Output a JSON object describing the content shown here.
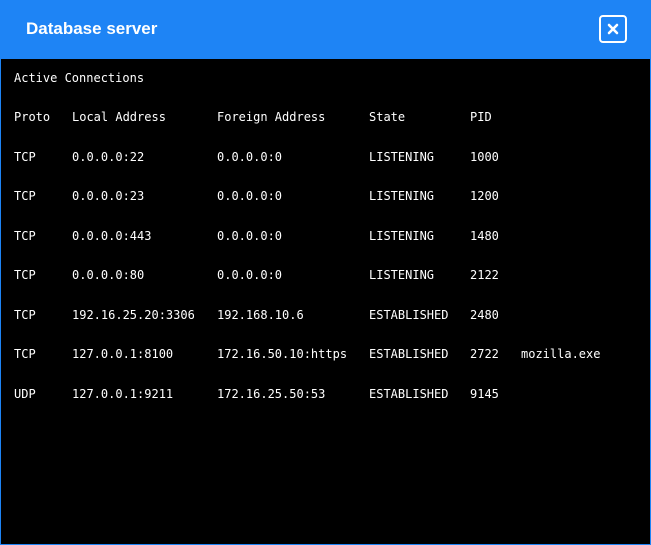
{
  "window": {
    "title": "Database server",
    "close_icon": "close-icon"
  },
  "colors": {
    "titlebar": "#1e84f5",
    "console_bg": "#000000",
    "text": "#ffffff"
  },
  "console": {
    "heading": "Active Connections",
    "columns": {
      "proto": "Proto",
      "local": "Local Address",
      "foreign": "Foreign Address",
      "state": "State",
      "pid": "PID"
    },
    "rows": [
      {
        "proto": "TCP",
        "local": "0.0.0.0:22",
        "foreign": "0.0.0.0:0",
        "state": "LISTENING",
        "pid": "1000",
        "process": ""
      },
      {
        "proto": "TCP",
        "local": "0.0.0.0:23",
        "foreign": "0.0.0.0:0",
        "state": "LISTENING",
        "pid": "1200",
        "process": ""
      },
      {
        "proto": "TCP",
        "local": "0.0.0.0:443",
        "foreign": "0.0.0.0:0",
        "state": "LISTENING",
        "pid": "1480",
        "process": ""
      },
      {
        "proto": "TCP",
        "local": "0.0.0.0:80",
        "foreign": "0.0.0.0:0",
        "state": "LISTENING",
        "pid": "2122",
        "process": ""
      },
      {
        "proto": "TCP",
        "local": "192.16.25.20:3306",
        "foreign": "192.168.10.6",
        "state": "ESTABLISHED",
        "pid": "2480",
        "process": ""
      },
      {
        "proto": "TCP",
        "local": "127.0.0.1:8100",
        "foreign": "172.16.50.10:https",
        "state": "ESTABLISHED",
        "pid": "2722",
        "process": "mozilla.exe"
      },
      {
        "proto": "UDP",
        "local": "127.0.0.1:9211",
        "foreign": "172.16.25.50:53",
        "state": "ESTABLISHED",
        "pid": "9145",
        "process": ""
      }
    ]
  }
}
